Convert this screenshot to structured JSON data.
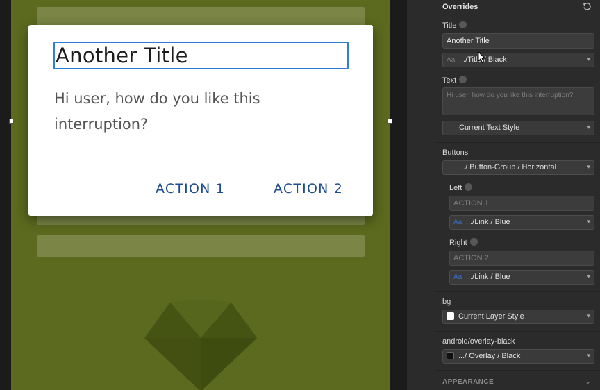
{
  "dialog": {
    "title": "Another Title",
    "text": "Hi user, how do you like this interruption?",
    "action1": "ACTION 1",
    "action2": "ACTION 2"
  },
  "panel": {
    "header": "Overrides",
    "title_label": "Title",
    "title_value": "Another Title",
    "title_style": ".../Title / Black",
    "text_label": "Text",
    "text_placeholder": "Hi user, how do you like this interruption?",
    "text_style": "Current Text Style",
    "buttons_label": "Buttons",
    "buttons_value": ".../ Button-Group / Horizontal",
    "left_label": "Left",
    "left_placeholder": "ACTION 1",
    "left_style": ".../Link / Blue",
    "right_label": "Right",
    "right_placeholder": "ACTION 2",
    "right_style": ".../Link / Blue",
    "bg_label": "bg",
    "bg_value": "Current Layer Style",
    "overlay_label": "android/overlay-black",
    "overlay_value": ".../ Overlay / Black",
    "appearance_label": "APPEARANCE",
    "aa_glyph": "Aa"
  },
  "colors": {
    "artboard": "#5b6a1e",
    "accent": "#2f7ed8",
    "link_blue": "#1f4e8c"
  }
}
